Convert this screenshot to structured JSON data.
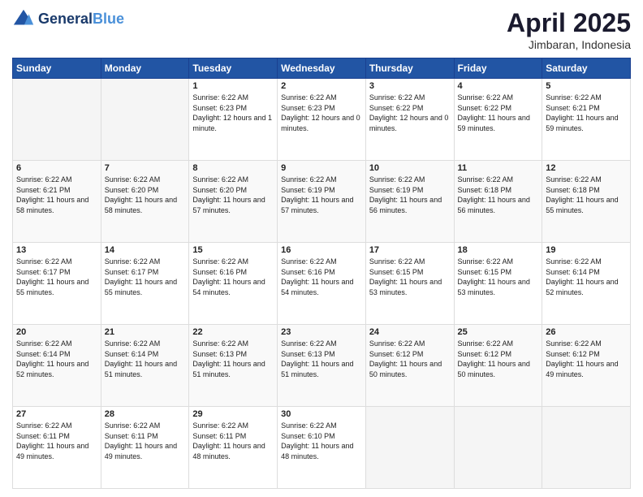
{
  "header": {
    "logo_line1": "General",
    "logo_line2": "Blue",
    "month_title": "April 2025",
    "subtitle": "Jimbaran, Indonesia"
  },
  "days_of_week": [
    "Sunday",
    "Monday",
    "Tuesday",
    "Wednesday",
    "Thursday",
    "Friday",
    "Saturday"
  ],
  "weeks": [
    [
      {
        "day": "",
        "info": ""
      },
      {
        "day": "",
        "info": ""
      },
      {
        "day": "1",
        "info": "Sunrise: 6:22 AM\nSunset: 6:23 PM\nDaylight: 12 hours and 1 minute."
      },
      {
        "day": "2",
        "info": "Sunrise: 6:22 AM\nSunset: 6:23 PM\nDaylight: 12 hours and 0 minutes."
      },
      {
        "day": "3",
        "info": "Sunrise: 6:22 AM\nSunset: 6:22 PM\nDaylight: 12 hours and 0 minutes."
      },
      {
        "day": "4",
        "info": "Sunrise: 6:22 AM\nSunset: 6:22 PM\nDaylight: 11 hours and 59 minutes."
      },
      {
        "day": "5",
        "info": "Sunrise: 6:22 AM\nSunset: 6:21 PM\nDaylight: 11 hours and 59 minutes."
      }
    ],
    [
      {
        "day": "6",
        "info": "Sunrise: 6:22 AM\nSunset: 6:21 PM\nDaylight: 11 hours and 58 minutes."
      },
      {
        "day": "7",
        "info": "Sunrise: 6:22 AM\nSunset: 6:20 PM\nDaylight: 11 hours and 58 minutes."
      },
      {
        "day": "8",
        "info": "Sunrise: 6:22 AM\nSunset: 6:20 PM\nDaylight: 11 hours and 57 minutes."
      },
      {
        "day": "9",
        "info": "Sunrise: 6:22 AM\nSunset: 6:19 PM\nDaylight: 11 hours and 57 minutes."
      },
      {
        "day": "10",
        "info": "Sunrise: 6:22 AM\nSunset: 6:19 PM\nDaylight: 11 hours and 56 minutes."
      },
      {
        "day": "11",
        "info": "Sunrise: 6:22 AM\nSunset: 6:18 PM\nDaylight: 11 hours and 56 minutes."
      },
      {
        "day": "12",
        "info": "Sunrise: 6:22 AM\nSunset: 6:18 PM\nDaylight: 11 hours and 55 minutes."
      }
    ],
    [
      {
        "day": "13",
        "info": "Sunrise: 6:22 AM\nSunset: 6:17 PM\nDaylight: 11 hours and 55 minutes."
      },
      {
        "day": "14",
        "info": "Sunrise: 6:22 AM\nSunset: 6:17 PM\nDaylight: 11 hours and 55 minutes."
      },
      {
        "day": "15",
        "info": "Sunrise: 6:22 AM\nSunset: 6:16 PM\nDaylight: 11 hours and 54 minutes."
      },
      {
        "day": "16",
        "info": "Sunrise: 6:22 AM\nSunset: 6:16 PM\nDaylight: 11 hours and 54 minutes."
      },
      {
        "day": "17",
        "info": "Sunrise: 6:22 AM\nSunset: 6:15 PM\nDaylight: 11 hours and 53 minutes."
      },
      {
        "day": "18",
        "info": "Sunrise: 6:22 AM\nSunset: 6:15 PM\nDaylight: 11 hours and 53 minutes."
      },
      {
        "day": "19",
        "info": "Sunrise: 6:22 AM\nSunset: 6:14 PM\nDaylight: 11 hours and 52 minutes."
      }
    ],
    [
      {
        "day": "20",
        "info": "Sunrise: 6:22 AM\nSunset: 6:14 PM\nDaylight: 11 hours and 52 minutes."
      },
      {
        "day": "21",
        "info": "Sunrise: 6:22 AM\nSunset: 6:14 PM\nDaylight: 11 hours and 51 minutes."
      },
      {
        "day": "22",
        "info": "Sunrise: 6:22 AM\nSunset: 6:13 PM\nDaylight: 11 hours and 51 minutes."
      },
      {
        "day": "23",
        "info": "Sunrise: 6:22 AM\nSunset: 6:13 PM\nDaylight: 11 hours and 51 minutes."
      },
      {
        "day": "24",
        "info": "Sunrise: 6:22 AM\nSunset: 6:12 PM\nDaylight: 11 hours and 50 minutes."
      },
      {
        "day": "25",
        "info": "Sunrise: 6:22 AM\nSunset: 6:12 PM\nDaylight: 11 hours and 50 minutes."
      },
      {
        "day": "26",
        "info": "Sunrise: 6:22 AM\nSunset: 6:12 PM\nDaylight: 11 hours and 49 minutes."
      }
    ],
    [
      {
        "day": "27",
        "info": "Sunrise: 6:22 AM\nSunset: 6:11 PM\nDaylight: 11 hours and 49 minutes."
      },
      {
        "day": "28",
        "info": "Sunrise: 6:22 AM\nSunset: 6:11 PM\nDaylight: 11 hours and 49 minutes."
      },
      {
        "day": "29",
        "info": "Sunrise: 6:22 AM\nSunset: 6:11 PM\nDaylight: 11 hours and 48 minutes."
      },
      {
        "day": "30",
        "info": "Sunrise: 6:22 AM\nSunset: 6:10 PM\nDaylight: 11 hours and 48 minutes."
      },
      {
        "day": "",
        "info": ""
      },
      {
        "day": "",
        "info": ""
      },
      {
        "day": "",
        "info": ""
      }
    ]
  ]
}
